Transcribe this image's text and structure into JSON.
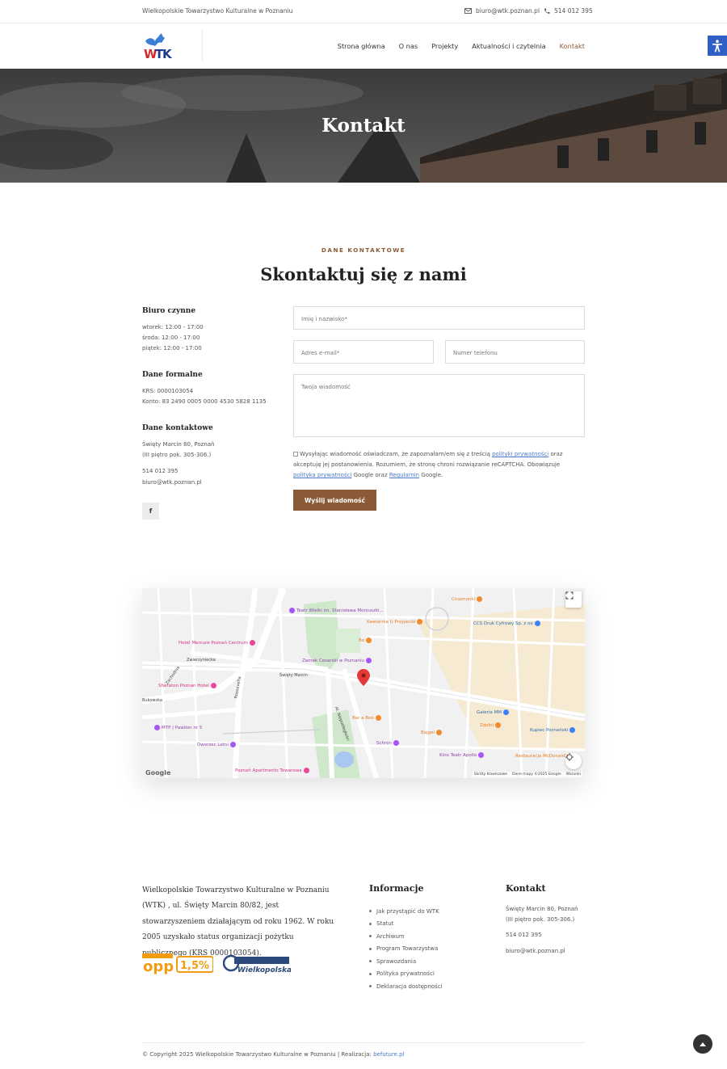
{
  "topbar": {
    "org_name": "Wielkopolskie Towarzystwo Kulturalne w Poznaniu",
    "email": "biuro@wtk.poznan.pl",
    "phone": "514 012 395"
  },
  "nav": {
    "items": [
      "Strona główna",
      "O nas",
      "Projekty",
      "Aktualności i czytelnia",
      "Kontakt"
    ],
    "active": "Kontakt"
  },
  "hero": {
    "title": "Kontakt"
  },
  "contact": {
    "eyebrow": "DANE KONTAKTOWE",
    "title": "Skontaktuj się z nami",
    "office": {
      "heading": "Biuro czynne",
      "hours": [
        "wtorek: 12:00 - 17:00",
        "środa: 12:00 - 17:00",
        "piątek: 12:00 - 17:00"
      ]
    },
    "formal": {
      "heading": "Dane formalne",
      "krs": "KRS: 0000103054",
      "account": "Konto: 83 2490 0005 0000 4530 5828 1135"
    },
    "details": {
      "heading": "Dane kontaktowe",
      "address1": "Święty Marcin 80, Poznań",
      "address2": "(III piętro pok. 305-306.)",
      "phone": "514 012 395",
      "email": "biuro@wtk.poznan.pl"
    },
    "facebook_label": "f"
  },
  "form": {
    "name_placeholder": "Imię i nazwisko*",
    "email_placeholder": "Adres e-mail*",
    "phone_placeholder": "Numer telefonu",
    "message_placeholder": "Twoja wiadomość",
    "consent_part1": "Wysyłając wiadomość oświadczam, że zapoznałam/em się z treścią",
    "consent_link1": "polityki prywatności",
    "consent_part2": "oraz akceptuję jej postanowienia. Rozumiem, że stronę chroni rozwiązanie reCAPTCHA. Obowiązuje",
    "consent_link2": "polityka prywatności",
    "consent_part3": "Google oraz",
    "consent_link3": "Regulamin",
    "consent_part4": "Google.",
    "submit_label": "Wyślij wiadomość"
  },
  "map": {
    "streets": [
      "Święty Marcin",
      "Zwierzyniecka",
      "Roosevelta",
      "Al. Niepodległości",
      "Zachodnia",
      "Bukowska"
    ],
    "pois": [
      "Teatr Wielki im. Stanisława Moniuszki...",
      "Kawiarnia U Przyjaciół",
      "Cinamonki",
      "CCS Druk Cyfrowy Sp. z oo",
      "Hotel Mercure Poznań Centrum",
      "Zamek Cesarski w Poznaniu",
      "Sheraton Poznan Hotel",
      "MTP | Pawilon nr 5",
      "Dworzec Letni",
      "Poznań Apartments Towarowa",
      "Bar a Boo",
      "Bajgel",
      "Galeria MM",
      "Zdolni",
      "Kupiec Poznański",
      "Kino Teatr Apollo",
      "Restauracja McDonald's",
      "Schron",
      "Bo"
    ],
    "shortcuts": "Skróty klawiszowe",
    "data": "Dane mapy ©2025 Google",
    "terms": "Warunki",
    "google": "Google"
  },
  "footer": {
    "about": "Wielkopolskie Towarzystwo Kulturalne w Poznaniu (WTK) , ul. Święty Marcin 80/82, jest stowarzyszeniem działającym od roku 1962. W roku 2005 uzyskało status organizacji pożytku publicznego (KRS 0000103054).",
    "info_heading": "Informacje",
    "info_links": [
      "Jak przystąpić do WTK",
      "Statut",
      "Archiwum",
      "Program Towarzystwa",
      "Sprawozdania",
      "Polityka prywatności",
      "Deklaracja dostępności"
    ],
    "contact_heading": "Kontakt",
    "contact_address1": "Święty Marcin 80, Poznań",
    "contact_address2": "(III piętro pok. 305-306.)",
    "contact_phone": "514 012 395",
    "contact_email": "biuro@wtk.poznan.pl",
    "badge_opp": "opp",
    "badge_percent": "1,5%",
    "badge_wielkopolska": "Wielkopolska",
    "copyright": "© Copyright 2025 Wielkopolskie Towarzystwo Kulturalne w Poznaniu | Realizacja:",
    "realization": "befuture.pl"
  },
  "colors": {
    "accent": "#8b5a36",
    "link": "#4a7bd0",
    "a11y": "#2f5fc4"
  }
}
